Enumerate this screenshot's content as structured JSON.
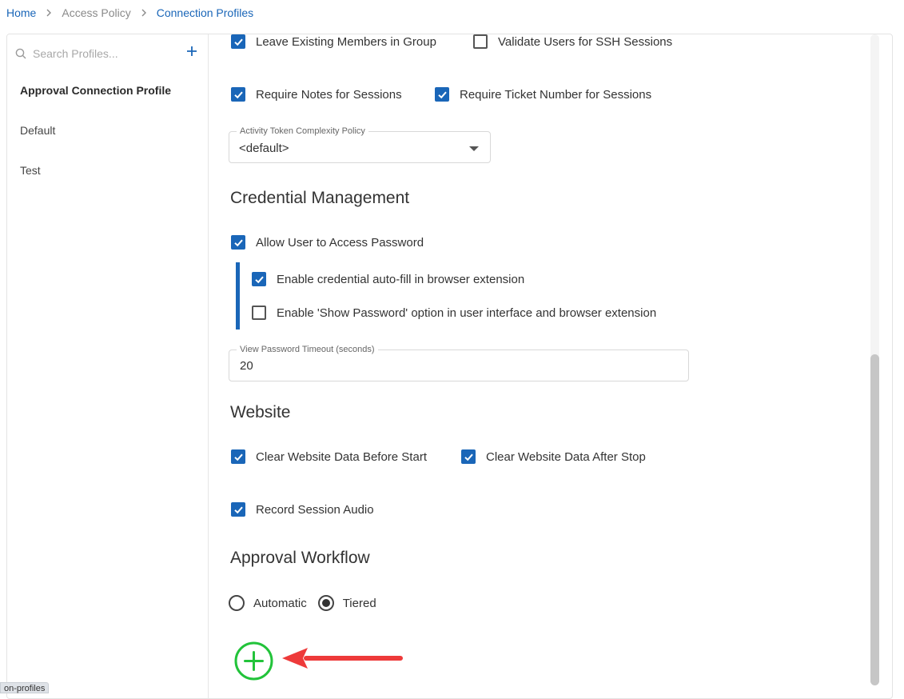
{
  "breadcrumb": {
    "home": "Home",
    "access_policy": "Access Policy",
    "connection_profiles": "Connection Profiles"
  },
  "sidebar": {
    "search_placeholder": "Search Profiles...",
    "profiles": [
      {
        "label": "Approval Connection Profile",
        "active": true
      },
      {
        "label": "Default",
        "active": false
      },
      {
        "label": "Test",
        "active": false
      }
    ]
  },
  "sessions": {
    "leave_members": {
      "label": "Leave Existing Members in Group",
      "checked": true
    },
    "validate_ssh": {
      "label": "Validate Users for SSH Sessions",
      "checked": false
    },
    "require_notes": {
      "label": "Require Notes for Sessions",
      "checked": true
    },
    "require_ticket": {
      "label": "Require Ticket Number for Sessions",
      "checked": true
    },
    "token_policy": {
      "legend": "Activity Token Complexity Policy",
      "value": "<default>"
    }
  },
  "credential_management": {
    "title": "Credential Management",
    "allow_access": {
      "label": "Allow User to Access Password",
      "checked": true
    },
    "autofill": {
      "label": "Enable credential auto-fill in browser extension",
      "checked": true
    },
    "show_password": {
      "label": "Enable 'Show Password' option in user interface and browser extension",
      "checked": false
    },
    "timeout": {
      "legend": "View Password Timeout (seconds)",
      "value": "20"
    }
  },
  "website": {
    "title": "Website",
    "clear_before": {
      "label": "Clear Website Data Before Start",
      "checked": true
    },
    "clear_after": {
      "label": "Clear Website Data After Stop",
      "checked": true
    },
    "record_audio": {
      "label": "Record Session Audio",
      "checked": true
    }
  },
  "approval_workflow": {
    "title": "Approval Workflow",
    "options": [
      {
        "label": "Automatic",
        "selected": false
      },
      {
        "label": "Tiered",
        "selected": true
      }
    ]
  },
  "status_tooltip": "on-profiles",
  "colors": {
    "accent": "#1a66b8",
    "add_button": "#22c33a",
    "annotation_arrow": "#ee3a3a"
  }
}
